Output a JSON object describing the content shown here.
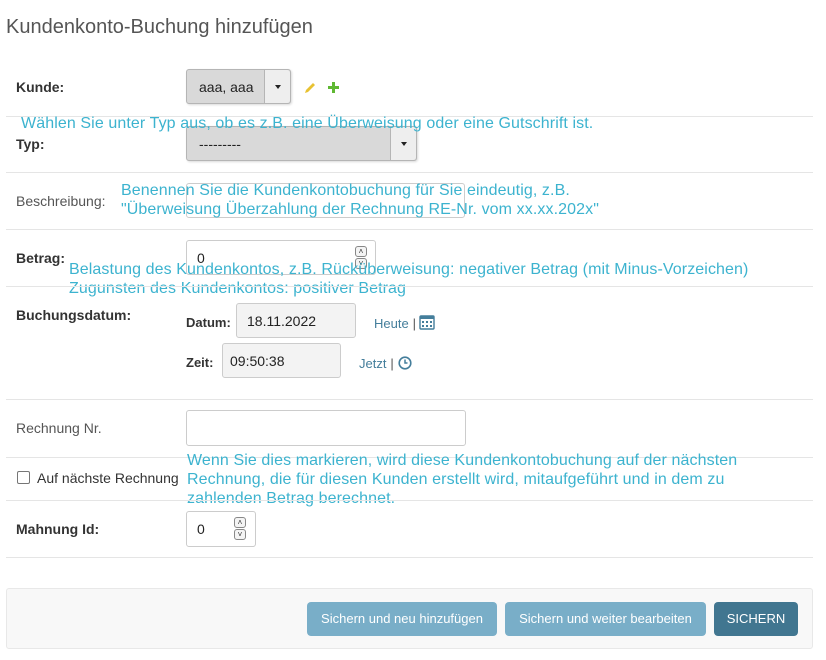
{
  "page": {
    "title": "Kundenkonto-Buchung hinzufügen"
  },
  "fields": {
    "kunde": {
      "label": "Kunde:",
      "value": "aaa, aaa"
    },
    "typ": {
      "label": "Typ:",
      "value": "---------",
      "help": "Wählen Sie unter Typ aus, ob es z.B. eine Überweisung oder eine Gutschrift ist."
    },
    "beschreibung": {
      "label": "Beschreibung:",
      "value": "",
      "help_line1": "Benennen Sie die Kundenkontobuchung für Sie eindeutig, z.B.",
      "help_line2": "\"Überweisung Überzahlung der Rechnung RE-Nr. vom xx.xx.202x\""
    },
    "betrag": {
      "label": "Betrag:",
      "value": "0",
      "help_line1": "Belastung des Kundenkontos, z.B. Rücküberweisung: negativer Betrag (mit Minus-Vorzeichen)",
      "help_line2": "Zugunsten des Kundenkontos: positiver Betrag"
    },
    "buchungsdatum": {
      "label": "Buchungsdatum:",
      "date_label": "Datum:",
      "date_value": "18.11.2022",
      "today_link": "Heute",
      "separator": "|",
      "time_label": "Zeit:",
      "time_value": "09:50:38",
      "now_link": "Jetzt"
    },
    "rechnung_nr": {
      "label": "Rechnung Nr.",
      "value": ""
    },
    "auf_naechste_rechnung": {
      "label": "Auf nächste Rechnung",
      "checked": false,
      "help_line1": "Wenn Sie dies markieren, wird diese Kundenkontobuchung auf der nächsten",
      "help_line2": "Rechnung, die für diesen Kunden erstellt wird, mitaufgeführt und in dem zu",
      "help_line3": "zahlenden Betrag berechnet."
    },
    "mahnung_id": {
      "label": "Mahnung Id:",
      "value": "0"
    }
  },
  "icons": {
    "edit": "pencil-icon",
    "add": "plus-icon",
    "calendar": "calendar-icon",
    "clock": "clock-icon"
  },
  "buttons": {
    "save_add": "Sichern und neu hinzufügen",
    "save_continue": "Sichern und weiter bearbeiten",
    "save": "SICHERN"
  },
  "colors": {
    "help_text": "#3cb3cf",
    "button_light": "#79aec8",
    "button_dark": "#417690",
    "link": "#447e9b",
    "add_icon": "#5fb832",
    "edit_icon": "#e8c232"
  }
}
